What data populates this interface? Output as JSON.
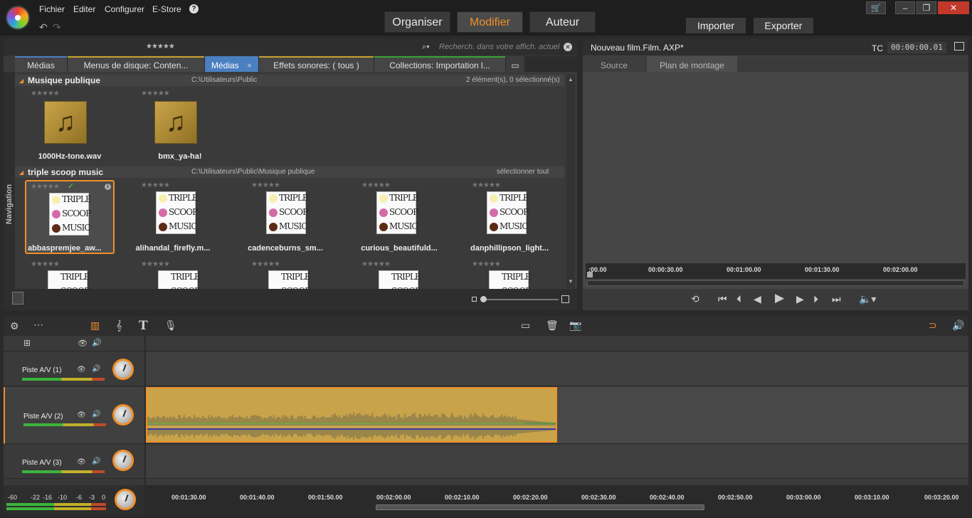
{
  "menu": [
    "Fichier",
    "Editer",
    "Configurer",
    "E-Store"
  ],
  "modes": [
    {
      "label": "Organiser"
    },
    {
      "label": "Modifier"
    },
    {
      "label": "Auteur"
    }
  ],
  "actions": {
    "import": "Importer",
    "export": "Exporter"
  },
  "library": {
    "search_placeholder": "Recherch. dans votre affich. actuel",
    "tabs": [
      {
        "label": "Médias"
      },
      {
        "label": "Menus de disque: Conten..."
      },
      {
        "label": "Médias",
        "close": "×"
      },
      {
        "label": "Effets sonores: ( tous )"
      },
      {
        "label": "Collections: Importation l..."
      }
    ],
    "nav_label": "Navigation",
    "groups": [
      {
        "title": "Musique publique",
        "path": "C:\\Utilisateurs\\Public",
        "info": "2 élément(s), 0 sélectionné(s)",
        "items": [
          "1000Hz-tone.wav",
          "bmx_ya-ha!"
        ]
      },
      {
        "title": "triple scoop music",
        "path": "C:\\Utilisateurs\\Public\\Musique publique",
        "info": "sélectionner tout",
        "items": [
          "abbaspremjee_aw...",
          "alihandal_firefly.m...",
          "cadenceburns_sm...",
          "curious_beautifuld...",
          "danphillipson_light..."
        ]
      }
    ],
    "tsm_lines": [
      "TRIPLE",
      "SCOOP",
      "MUSIC"
    ]
  },
  "preview": {
    "title": "Nouveau film.Film. AXP*",
    "tc_label": "TC",
    "timecode": "00:00:00.01",
    "tabs": [
      "Source",
      "Plan de montage"
    ],
    "ruler": [
      ":00.00",
      "00:00:30.00",
      "00:01:00.00",
      "00:01:30.00",
      "00:02:00.00"
    ]
  },
  "timeline": {
    "tracks": [
      "Piste A/V (1)",
      "Piste A/V (2)",
      "Piste A/V (3)"
    ],
    "meter_scale": [
      "-60",
      "-22",
      "-16",
      "-10",
      "-6",
      "-3",
      "0"
    ],
    "ruler": [
      "00:01:30.00",
      "00:01:40.00",
      "00:01:50.00",
      "00:02:00.00",
      "00:02:10.00",
      "00:02:20.00",
      "00:02:30.00",
      "00:02:40.00",
      "00:02:50.00",
      "00:03:00.00",
      "00:03:10.00",
      "00:03:20.00"
    ]
  },
  "colors": {
    "accent": "#f0902a",
    "tab_active": "#4a7fc0",
    "clip": "#c9a34a"
  }
}
